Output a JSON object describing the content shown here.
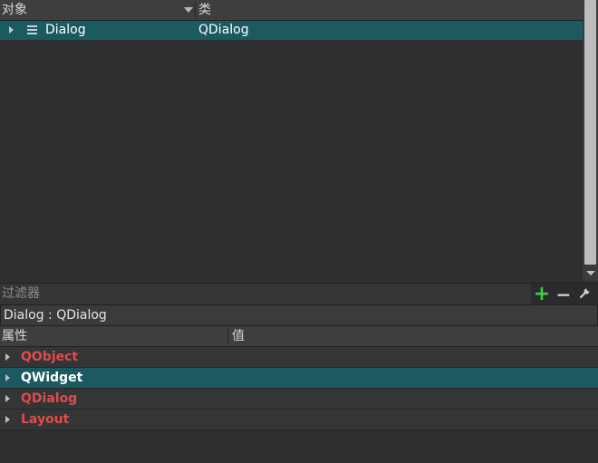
{
  "object_inspector": {
    "columns": [
      "对象",
      "类"
    ],
    "rows": [
      {
        "name": "Dialog",
        "class": "QDialog",
        "icon": "list-icon",
        "selected": true
      }
    ]
  },
  "filter": {
    "placeholder": "过滤器",
    "value": "",
    "tools": {
      "add": "add-icon",
      "remove": "remove-icon",
      "configure": "wrench-icon"
    }
  },
  "current_object": "Dialog : QDialog",
  "property_editor": {
    "columns": [
      "属性",
      "值"
    ],
    "groups": [
      {
        "label": "QObject",
        "selected": false
      },
      {
        "label": "QWidget",
        "selected": true
      },
      {
        "label": "QDialog",
        "selected": false
      },
      {
        "label": "Layout",
        "selected": false
      }
    ]
  },
  "colors": {
    "selection": "#1c5a62",
    "group_label": "#e04b4b",
    "background": "#2e2f30"
  }
}
